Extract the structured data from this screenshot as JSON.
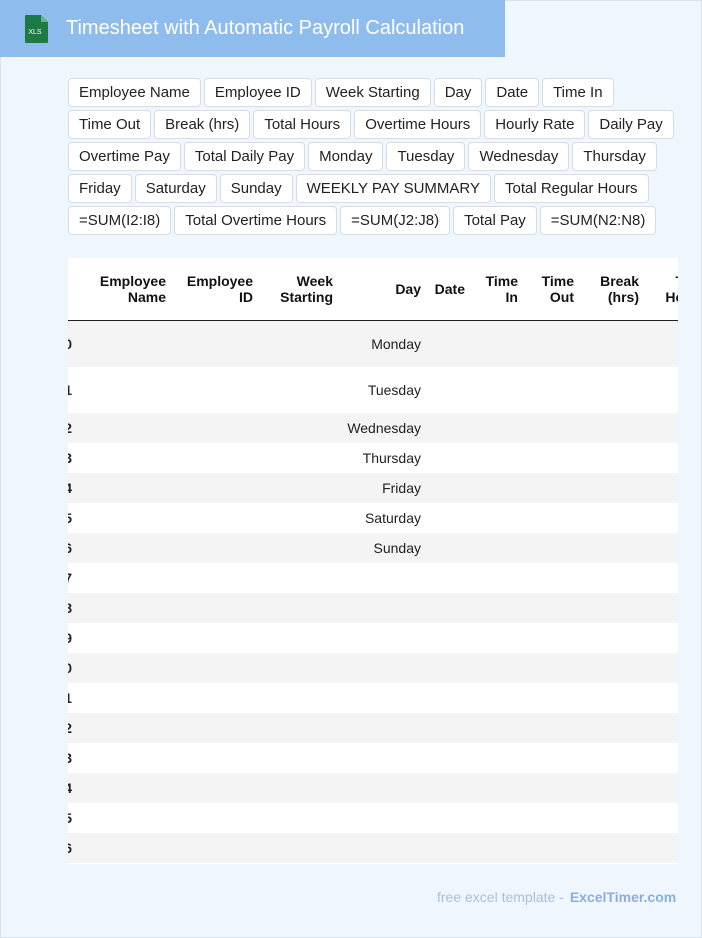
{
  "header": {
    "title": "Timesheet with Automatic Payroll Calculation",
    "icon_label": "XLS",
    "bg_color": "#8ebcec",
    "icon_color": "#1e7a45"
  },
  "chips": [
    "Employee Name",
    "Employee ID",
    "Week Starting",
    "Day",
    "Date",
    "Time In",
    "Time Out",
    "Break (hrs)",
    "Total Hours",
    "Overtime Hours",
    "Hourly Rate",
    "Daily Pay",
    "Overtime Pay",
    "Total Daily Pay",
    "Monday",
    "Tuesday",
    "Wednesday",
    "Thursday",
    "Friday",
    "Saturday",
    "Sunday",
    "WEEKLY PAY SUMMARY",
    "Total Regular Hours",
    "=SUM(I2:I8)",
    "Total Overtime Hours",
    "=SUM(J2:J8)",
    "Total Pay",
    "=SUM(N2:N8)"
  ],
  "table": {
    "columns": [
      {
        "line1": "Employee",
        "line2": "Name"
      },
      {
        "line1": "Employee",
        "line2": "ID"
      },
      {
        "line1": "Week",
        "line2": "Starting"
      },
      {
        "line1": "Day",
        "line2": ""
      },
      {
        "line1": "Date",
        "line2": ""
      },
      {
        "line1": "Time",
        "line2": "In"
      },
      {
        "line1": "Time",
        "line2": "Out"
      },
      {
        "line1": "Break",
        "line2": "(hrs)"
      },
      {
        "line1": "T",
        "line2": "Ho"
      }
    ],
    "rows": [
      {
        "idx": "0",
        "day": "Monday"
      },
      {
        "idx": "1",
        "day": "Tuesday"
      },
      {
        "idx": "2",
        "day": "Wednesday"
      },
      {
        "idx": "3",
        "day": "Thursday"
      },
      {
        "idx": "4",
        "day": "Friday"
      },
      {
        "idx": "5",
        "day": "Saturday"
      },
      {
        "idx": "6",
        "day": "Sunday"
      },
      {
        "idx": "7",
        "day": ""
      },
      {
        "idx": "8",
        "day": ""
      },
      {
        "idx": "9",
        "day": ""
      },
      {
        "idx": "0",
        "day": ""
      },
      {
        "idx": "1",
        "day": ""
      },
      {
        "idx": "2",
        "day": ""
      },
      {
        "idx": "3",
        "day": ""
      },
      {
        "idx": "4",
        "day": ""
      },
      {
        "idx": "5",
        "day": ""
      },
      {
        "idx": "6",
        "day": ""
      }
    ]
  },
  "footer": {
    "text": "free excel template -",
    "brand": "ExcelTimer.com"
  }
}
